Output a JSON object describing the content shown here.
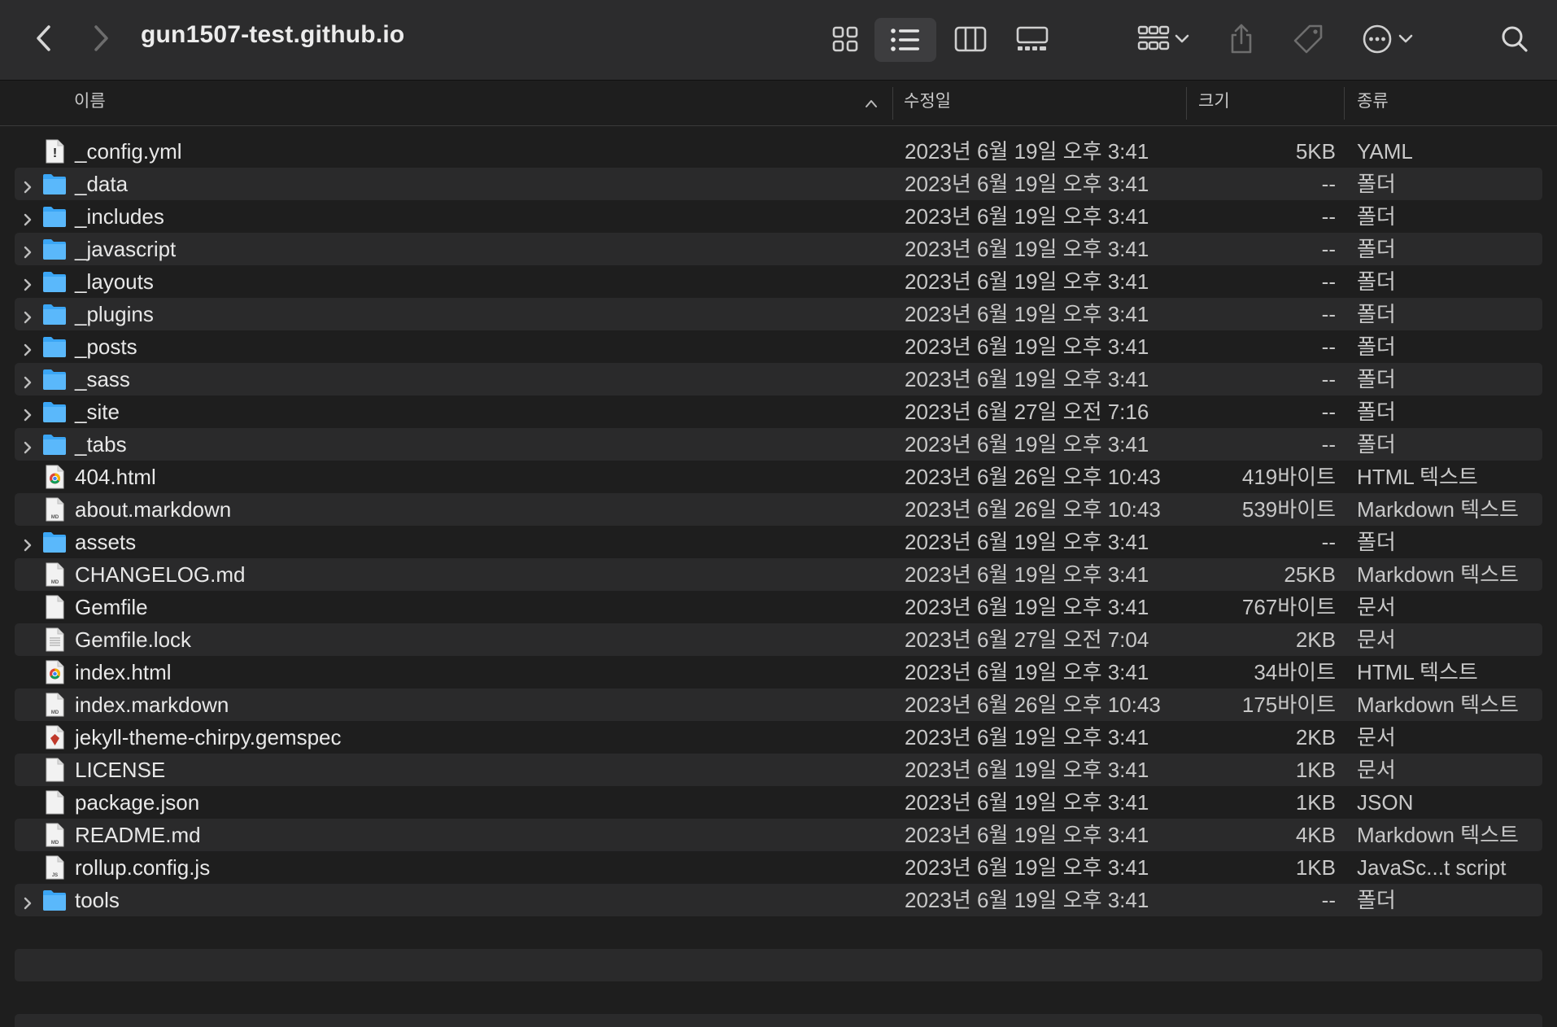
{
  "toolbar": {
    "title": "gun1507-test.github.io"
  },
  "columns": {
    "name": "이름",
    "modified": "수정일",
    "size": "크기",
    "kind": "종류"
  },
  "colors": {
    "folder": "#3ba6f5",
    "background": "#1e1e1e",
    "toolbar": "#2c2c2d",
    "stripe": "#2a2a2b"
  },
  "files": [
    {
      "name": "_config.yml",
      "date": "2023년 6월 19일 오후 3:41",
      "size": "5KB",
      "kind": "YAML",
      "icon": "yaml-file-icon",
      "folder": false
    },
    {
      "name": "_data",
      "date": "2023년 6월 19일 오후 3:41",
      "size": "--",
      "kind": "폴더",
      "icon": "folder-icon",
      "folder": true
    },
    {
      "name": "_includes",
      "date": "2023년 6월 19일 오후 3:41",
      "size": "--",
      "kind": "폴더",
      "icon": "folder-icon",
      "folder": true
    },
    {
      "name": "_javascript",
      "date": "2023년 6월 19일 오후 3:41",
      "size": "--",
      "kind": "폴더",
      "icon": "folder-icon",
      "folder": true
    },
    {
      "name": "_layouts",
      "date": "2023년 6월 19일 오후 3:41",
      "size": "--",
      "kind": "폴더",
      "icon": "folder-icon",
      "folder": true
    },
    {
      "name": "_plugins",
      "date": "2023년 6월 19일 오후 3:41",
      "size": "--",
      "kind": "폴더",
      "icon": "folder-icon",
      "folder": true
    },
    {
      "name": "_posts",
      "date": "2023년 6월 19일 오후 3:41",
      "size": "--",
      "kind": "폴더",
      "icon": "folder-icon",
      "folder": true
    },
    {
      "name": "_sass",
      "date": "2023년 6월 19일 오후 3:41",
      "size": "--",
      "kind": "폴더",
      "icon": "folder-icon",
      "folder": true
    },
    {
      "name": "_site",
      "date": "2023년 6월 27일 오전 7:16",
      "size": "--",
      "kind": "폴더",
      "icon": "folder-icon",
      "folder": true
    },
    {
      "name": "_tabs",
      "date": "2023년 6월 19일 오후 3:41",
      "size": "--",
      "kind": "폴더",
      "icon": "folder-icon",
      "folder": true
    },
    {
      "name": "404.html",
      "date": "2023년 6월 26일 오후 10:43",
      "size": "419바이트",
      "kind": "HTML 텍스트",
      "icon": "html-file-icon",
      "folder": false
    },
    {
      "name": "about.markdown",
      "date": "2023년 6월 26일 오후 10:43",
      "size": "539바이트",
      "kind": "Markdown 텍스트",
      "icon": "markdown-file-icon",
      "folder": false
    },
    {
      "name": "assets",
      "date": "2023년 6월 19일 오후 3:41",
      "size": "--",
      "kind": "폴더",
      "icon": "folder-icon",
      "folder": true
    },
    {
      "name": "CHANGELOG.md",
      "date": "2023년 6월 19일 오후 3:41",
      "size": "25KB",
      "kind": "Markdown 텍스트",
      "icon": "markdown-file-icon",
      "folder": false
    },
    {
      "name": "Gemfile",
      "date": "2023년 6월 19일 오후 3:41",
      "size": "767바이트",
      "kind": "문서",
      "icon": "document-icon",
      "folder": false
    },
    {
      "name": "Gemfile.lock",
      "date": "2023년 6월 27일 오전 7:04",
      "size": "2KB",
      "kind": "문서",
      "icon": "text-document-icon",
      "folder": false
    },
    {
      "name": "index.html",
      "date": "2023년 6월 19일 오후 3:41",
      "size": "34바이트",
      "kind": "HTML 텍스트",
      "icon": "html-file-icon",
      "folder": false
    },
    {
      "name": "index.markdown",
      "date": "2023년 6월 26일 오후 10:43",
      "size": "175바이트",
      "kind": "Markdown 텍스트",
      "icon": "markdown-file-icon",
      "folder": false
    },
    {
      "name": "jekyll-theme-chirpy.gemspec",
      "date": "2023년 6월 19일 오후 3:41",
      "size": "2KB",
      "kind": "문서",
      "icon": "gemspec-file-icon",
      "folder": false
    },
    {
      "name": "LICENSE",
      "date": "2023년 6월 19일 오후 3:41",
      "size": "1KB",
      "kind": "문서",
      "icon": "document-icon",
      "folder": false
    },
    {
      "name": "package.json",
      "date": "2023년 6월 19일 오후 3:41",
      "size": "1KB",
      "kind": "JSON",
      "icon": "json-file-icon",
      "folder": false
    },
    {
      "name": "README.md",
      "date": "2023년 6월 19일 오후 3:41",
      "size": "4KB",
      "kind": "Markdown 텍스트",
      "icon": "markdown-file-icon",
      "folder": false
    },
    {
      "name": "rollup.config.js",
      "date": "2023년 6월 19일 오후 3:41",
      "size": "1KB",
      "kind": "JavaSc...t script",
      "icon": "js-file-icon",
      "folder": false
    },
    {
      "name": "tools",
      "date": "2023년 6월 19일 오후 3:41",
      "size": "--",
      "kind": "폴더",
      "icon": "folder-icon",
      "folder": true
    }
  ]
}
